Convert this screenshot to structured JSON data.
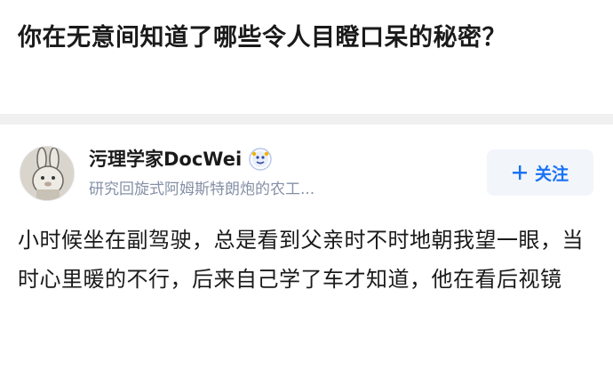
{
  "question": {
    "title": "你在无意间知道了哪些令人目瞪口呆的秘密？"
  },
  "answer": {
    "author": {
      "name": "污理学家DocWei",
      "bio": "研究回旋式阿姆斯特朗炮的农工...",
      "avatar_icon": "cartoon-rabbit-avatar",
      "badge_icon": "verified-badge-icon"
    },
    "follow_button": {
      "label": "关注",
      "icon": "plus-icon"
    },
    "content": "小时候坐在副驾驶，总是看到父亲时不时地朝我望一眼，当时心里暖的不行，后来自己学了车才知道，他在看后视镜"
  },
  "colors": {
    "accent": "#1772f6",
    "follow_bg": "#f2f5fa",
    "muted_text": "#8590a6",
    "divider": "#f0f0f0"
  }
}
